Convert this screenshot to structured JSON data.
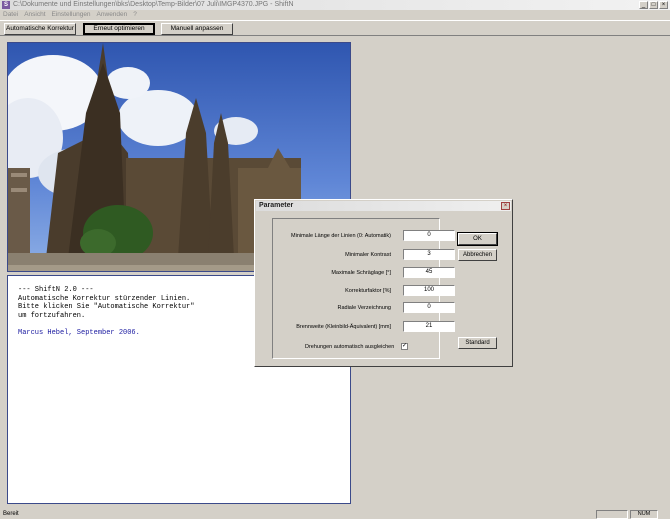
{
  "window": {
    "title": "C:\\Dokumente und Einstellungen\\bks\\Desktop\\Temp-Bilder\\07 Juli\\IMGP4370.JPG - ShiftN",
    "app_icon": "S",
    "minimize": "_",
    "maximize": "□",
    "close": "×"
  },
  "menu": [
    "Datei",
    "Ansicht",
    "Einstellungen",
    "Anwenden",
    "?"
  ],
  "toolbar": {
    "auto_label": "Automatische Korrektur",
    "optimize_label": "Erneut optimieren",
    "manual_label": "Manuell anpassen"
  },
  "text_panel": {
    "lines": "--- ShiftN 2.0 ---\nAutomatische Korrektur stürzender Linien.\nBitte klicken Sie \"Automatische Korrektur\"\num fortzufahren.",
    "credit": "Marcus Hebel, September 2006."
  },
  "status": {
    "text": "Bereit",
    "num": "NUM"
  },
  "dialog": {
    "title": "Parameter",
    "close": "×",
    "params": [
      {
        "label": "Minimale Länge der Linien (0: Automatik)",
        "value": "0"
      },
      {
        "label": "Minimaler Kontrast",
        "value": "3"
      },
      {
        "label": "Maximale Schräglage [°]",
        "value": "45"
      },
      {
        "label": "Korrekturfaktor [%]",
        "value": "100"
      },
      {
        "label": "Radiale Verzeichnung",
        "value": "0"
      },
      {
        "label": "Brennweite (Kleinbild-Äquivalent) [mm]",
        "value": "21"
      }
    ],
    "checkbox_label": "Drehungen automatisch ausgleichen",
    "checkbox_mark": "✓",
    "checkbox_checked": true,
    "ok_label": "OK",
    "cancel_label": "Abbrechen",
    "standard_label": "Standard"
  }
}
